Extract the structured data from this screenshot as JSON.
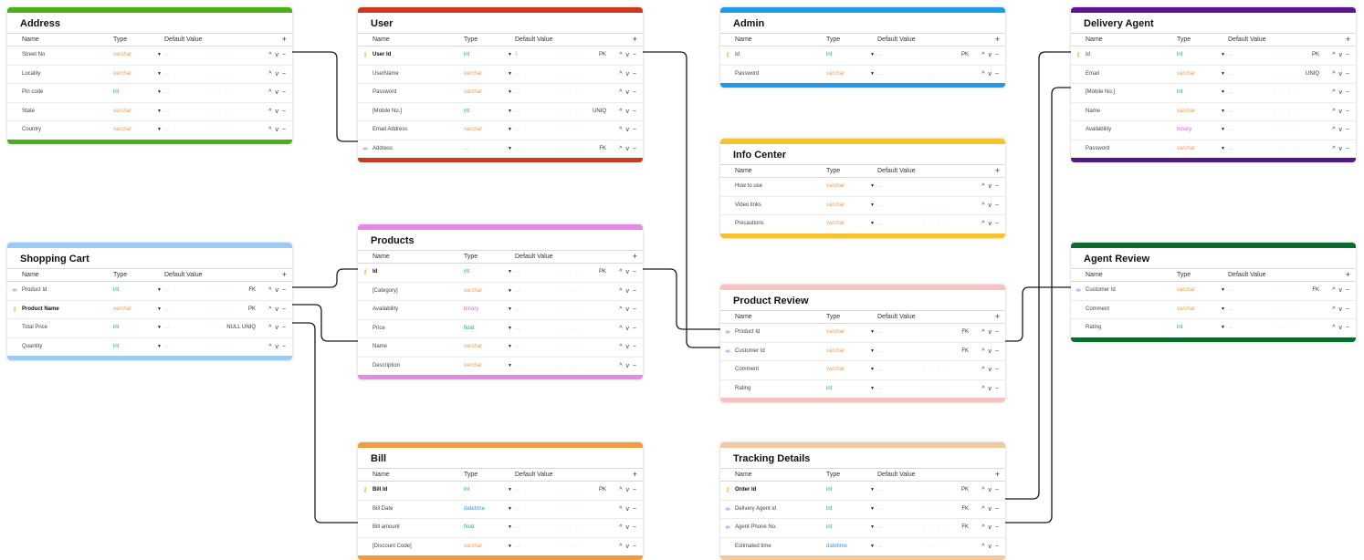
{
  "header": {
    "name": "Name",
    "type": "Type",
    "default": "Default Value",
    "add": "+"
  },
  "row_controls": "^ v −",
  "default_placeholder": "...",
  "caret": "▼",
  "row_dots": ". . . . .",
  "icons": {
    "pk": "key-icon",
    "fk": "link-icon"
  },
  "tables": {
    "address": {
      "title": "Address",
      "color": "#4caf1a",
      "rows": [
        {
          "name": "Street No",
          "type": "varchar",
          "cons": ""
        },
        {
          "name": "Locality",
          "type": "varchar",
          "cons": ""
        },
        {
          "name": "Pin code",
          "type": "int",
          "cons": ""
        },
        {
          "name": "State",
          "type": "varchar",
          "cons": ""
        },
        {
          "name": "Country",
          "type": "varchar",
          "cons": ""
        }
      ]
    },
    "user": {
      "title": "User",
      "color": "#cc3a1c",
      "rows": [
        {
          "name": "User Id",
          "type": "int",
          "default": "0",
          "cons": "PK",
          "icon": "pk",
          "bold": true
        },
        {
          "name": "UserName",
          "type": "varchar",
          "cons": ""
        },
        {
          "name": "Password",
          "type": "varchar",
          "cons": ""
        },
        {
          "name": "[Mobile No.]",
          "type": "int",
          "cons": "UNIQ"
        },
        {
          "name": "Email Address",
          "type": "varchar",
          "cons": ""
        },
        {
          "name": "Address",
          "type": "...",
          "cons": "FK",
          "icon": "fk"
        }
      ]
    },
    "admin": {
      "title": "Admin",
      "color": "#1e9be8",
      "rows": [
        {
          "name": "Id",
          "type": "int",
          "cons": "PK",
          "icon": "pk"
        },
        {
          "name": "Password",
          "type": "varchar",
          "cons": ""
        }
      ]
    },
    "delivery_agent": {
      "title": "Delivery Agent",
      "color": "#5b1390",
      "rows": [
        {
          "name": "Id",
          "type": "int",
          "cons": "PK",
          "icon": "pk"
        },
        {
          "name": "Email",
          "type": "varchar",
          "cons": "UNIQ"
        },
        {
          "name": "[Mobile No.]",
          "type": "int",
          "cons": ""
        },
        {
          "name": "Name",
          "type": "varchar",
          "cons": ""
        },
        {
          "name": "Availability",
          "type": "binary",
          "cons": ""
        },
        {
          "name": "Password",
          "type": "varchar",
          "cons": ""
        }
      ]
    },
    "info_center": {
      "title": "Info Center",
      "color": "#f6c232",
      "rows": [
        {
          "name": "How to use",
          "type": "varchar",
          "cons": ""
        },
        {
          "name": "Video links",
          "type": "varchar",
          "cons": ""
        },
        {
          "name": "Precautions",
          "type": "varchar",
          "cons": ""
        }
      ]
    },
    "shopping_cart": {
      "title": "Shopping Cart",
      "color": "#9ecbf4",
      "rows": [
        {
          "name": "Product Id",
          "type": "int",
          "cons": "FK",
          "icon": "fk"
        },
        {
          "name": "Product Name",
          "type": "varchar",
          "cons": "PK",
          "icon": "pk",
          "bold": true
        },
        {
          "name": "Total Price",
          "type": "int",
          "cons": "NULL UNIQ"
        },
        {
          "name": "Quantity",
          "type": "int",
          "cons": ""
        }
      ]
    },
    "products": {
      "title": "Products",
      "color": "#e489e4",
      "rows": [
        {
          "name": "Id",
          "type": "int",
          "cons": "PK",
          "icon": "pk",
          "bold": true
        },
        {
          "name": "[Category]",
          "type": "varchar",
          "cons": ""
        },
        {
          "name": "Availability",
          "type": "binary",
          "cons": ""
        },
        {
          "name": "Price",
          "type": "float",
          "cons": ""
        },
        {
          "name": "Name",
          "type": "varchar",
          "cons": ""
        },
        {
          "name": "Description",
          "type": "varchar",
          "cons": ""
        }
      ]
    },
    "product_review": {
      "title": "Product Review",
      "color": "#f6c2c2",
      "rows": [
        {
          "name": "Product Id",
          "type": "varchar",
          "cons": "FK",
          "icon": "fk"
        },
        {
          "name": "Customer Id",
          "type": "varchar",
          "cons": "FK",
          "icon": "fk"
        },
        {
          "name": "Comment",
          "type": "varchar",
          "cons": ""
        },
        {
          "name": "Rating",
          "type": "int",
          "cons": ""
        }
      ]
    },
    "agent_review": {
      "title": "Agent Review",
      "color": "#0b6b30",
      "rows": [
        {
          "name": "Customer Id",
          "type": "varchar",
          "cons": "FK",
          "icon": "fk"
        },
        {
          "name": "Comment",
          "type": "varchar",
          "cons": ""
        },
        {
          "name": "Rating",
          "type": "int",
          "cons": ""
        }
      ]
    },
    "bill": {
      "title": "Bill",
      "color": "#f29a3c",
      "rows": [
        {
          "name": "Bill Id",
          "type": "int",
          "cons": "PK",
          "icon": "pk",
          "bold": true
        },
        {
          "name": "Bill Date",
          "type": "datetime",
          "cons": ""
        },
        {
          "name": "Bill amount",
          "type": "float",
          "cons": ""
        },
        {
          "name": "[Discount Code]",
          "type": "varchar",
          "cons": ""
        }
      ]
    },
    "tracking_details": {
      "title": "Tracking Details",
      "color": "#f5c79e",
      "rows": [
        {
          "name": "Order Id",
          "type": "int",
          "cons": "PK",
          "icon": "pk",
          "bold": true
        },
        {
          "name": "Delivery Agent id",
          "type": "int",
          "cons": "FK",
          "icon": "fk"
        },
        {
          "name": "Agent Phone No.",
          "type": "int",
          "cons": "FK",
          "icon": "fk"
        },
        {
          "name": "Estimated time",
          "type": "datetime",
          "cons": ""
        }
      ]
    }
  }
}
